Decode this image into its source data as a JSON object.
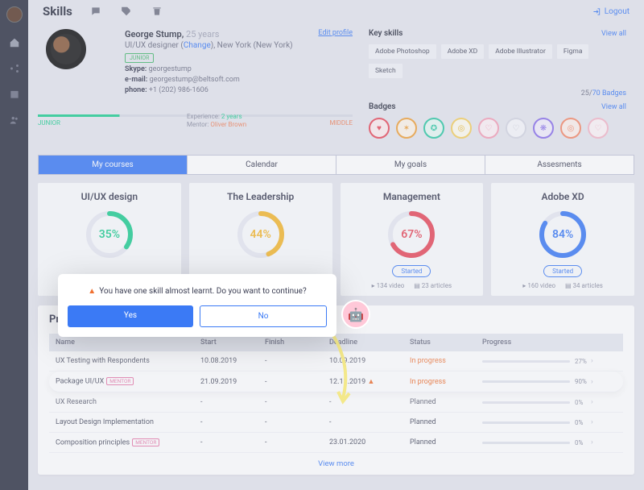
{
  "page_title": "Skills",
  "logout": "Logout",
  "profile": {
    "name": "George Stump,",
    "age": "25 years",
    "role_pre": "UI/UX designer (",
    "role_link": "Change",
    "role_post": "), New York (New York)",
    "level_badge": "JUNIOR",
    "skype_label": "Skype:",
    "skype": "georgestump",
    "email_label": "e-mail:",
    "email": "georgestump@beltsoft.com",
    "phone_label": "phone:",
    "phone": "+1 (202) 986-1606",
    "edit": "Edit profile",
    "xp_junior": "JUNIOR",
    "xp_middle": "MIDDLE",
    "xp_label": "Experience:",
    "xp_val": "2 years",
    "mentor_label": "Mentor:",
    "mentor": "Oliver Brown"
  },
  "key_skills": {
    "title": "Key skills",
    "view_all": "View all",
    "chips": [
      "Adobe Photoshop",
      "Adobe XD",
      "Adobe Illustrator",
      "Figma",
      "Sketch"
    ]
  },
  "badges": {
    "count_pre": "25/",
    "count_link": "70 Badges",
    "title": "Badges",
    "view_all": "View all"
  },
  "tabs": [
    "My courses",
    "Calendar",
    "My goals",
    "Assesments"
  ],
  "courses": [
    {
      "title": "UI/UX design",
      "pct": 35,
      "color": "#1fce90"
    },
    {
      "title": "The Leadership",
      "pct": 44,
      "color": "#f5b82e"
    },
    {
      "title": "Management",
      "pct": 67,
      "color": "#e84a5a",
      "started": "Started",
      "video": "134 video",
      "articles": "23 articles"
    },
    {
      "title": "Adobe XD",
      "pct": 84,
      "color": "#3b7af5",
      "started": "Started",
      "video": "160 video",
      "articles": "34 articles"
    }
  ],
  "modal": {
    "text": "You have one skill almost learnt. Do you want to continue?",
    "yes": "Yes",
    "no": "No"
  },
  "growth": {
    "title": "Professional growth",
    "headers": {
      "name": "Name",
      "start": "Start",
      "finish": "Finish",
      "deadline": "Deadline",
      "status": "Status",
      "progress": "Progress"
    },
    "rows": [
      {
        "name": "UX Testing with Respondents",
        "start": "10.08.2019",
        "finish": "-",
        "deadline": "10.09.2019",
        "status": "In progress",
        "sp": true,
        "pct": 27
      },
      {
        "name": "Package UI/UX",
        "mentor": "MENTOR",
        "start": "21.09.2019",
        "finish": "-",
        "deadline": "12.11.2019",
        "fire": true,
        "status": "In progress",
        "sp": true,
        "pct": 90,
        "hl": true
      },
      {
        "name": "UX Research",
        "start": "-",
        "finish": "-",
        "deadline": "-",
        "status": "Planned",
        "pct": 0
      },
      {
        "name": "Layout Design Implementation",
        "start": "-",
        "finish": "-",
        "deadline": "-",
        "status": "Planned",
        "pct": 0
      },
      {
        "name": "Composition principles",
        "mentor": "MENTOR",
        "start": "-",
        "finish": "-",
        "deadline": "23.01.2020",
        "status": "Planned",
        "pct": 0
      }
    ],
    "view_more": "View more"
  }
}
